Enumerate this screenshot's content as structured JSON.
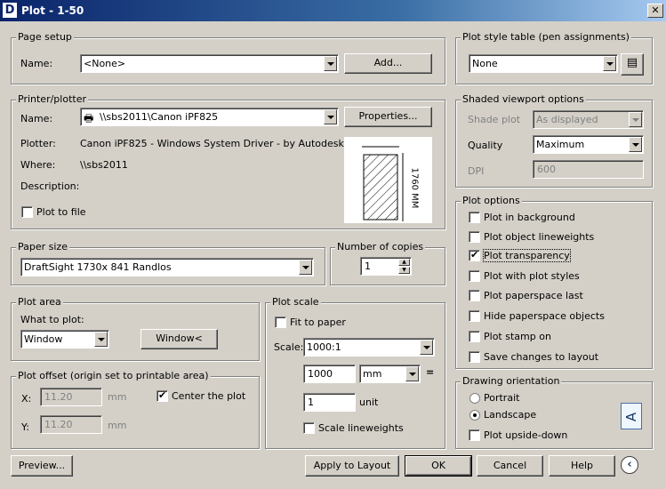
{
  "window": {
    "title": "Plot - 1-50"
  },
  "page_setup": {
    "legend": "Page setup",
    "name_label": "Name:",
    "name_value": "<None>",
    "add_button": "Add..."
  },
  "printer": {
    "legend": "Printer/plotter",
    "name_label": "Name:",
    "name_value": "\\\\sbs2011\\Canon iPF825",
    "properties_button": "Properties...",
    "plotter_label": "Plotter:",
    "plotter_value": "Canon iPF825 - Windows System Driver - by Autodesk",
    "where_label": "Where:",
    "where_value": "\\\\sbs2011",
    "description_label": "Description:",
    "plot_to_file_label": "Plot to file",
    "plot_to_file_checked": false,
    "preview_dimension": "1760 MM"
  },
  "paper_size": {
    "legend": "Paper size",
    "value": "DraftSight 1730x 841 Randlos"
  },
  "copies": {
    "legend": "Number of copies",
    "value": "1"
  },
  "plot_area": {
    "legend": "Plot area",
    "what_label": "What to plot:",
    "what_value": "Window",
    "window_button": "Window<"
  },
  "plot_offset": {
    "legend": "Plot offset (origin set to printable area)",
    "x_label": "X:",
    "x_value": "11.20",
    "x_unit": "mm",
    "y_label": "Y:",
    "y_value": "11.20",
    "y_unit": "mm",
    "center_label": "Center the plot",
    "center_checked": true
  },
  "plot_scale": {
    "legend": "Plot scale",
    "fit_label": "Fit to paper",
    "fit_checked": false,
    "scale_label": "Scale:",
    "scale_value": "1000:1",
    "amount_value": "1000",
    "unit_combo_value": "mm",
    "equals": "=",
    "unit_amount_value": "1",
    "unit_label": "unit",
    "lineweights_label": "Scale lineweights",
    "lineweights_checked": false
  },
  "plot_style": {
    "legend": "Plot style table (pen assignments)",
    "value": "None"
  },
  "shaded": {
    "legend": "Shaded viewport options",
    "shade_label": "Shade plot",
    "shade_value": "As displayed",
    "quality_label": "Quality",
    "quality_value": "Maximum",
    "dpi_label": "DPI",
    "dpi_value": "600"
  },
  "plot_options": {
    "legend": "Plot options",
    "items": [
      {
        "label": "Plot in background",
        "checked": false
      },
      {
        "label": "Plot object lineweights",
        "checked": false
      },
      {
        "label": "Plot transparency",
        "checked": true
      },
      {
        "label": "Plot with plot styles",
        "checked": false
      },
      {
        "label": "Plot paperspace last",
        "checked": false
      },
      {
        "label": "Hide paperspace objects",
        "checked": false
      },
      {
        "label": "Plot stamp on",
        "checked": false
      },
      {
        "label": "Save changes to layout",
        "checked": false
      }
    ]
  },
  "orientation": {
    "legend": "Drawing orientation",
    "portrait_label": "Portrait",
    "landscape_label": "Landscape",
    "selected": "Landscape",
    "upside_down_label": "Plot upside-down",
    "upside_down_checked": false,
    "icon_letter": "A"
  },
  "buttons": {
    "preview": "Preview...",
    "apply": "Apply to Layout",
    "ok": "OK",
    "cancel": "Cancel",
    "help": "Help"
  }
}
